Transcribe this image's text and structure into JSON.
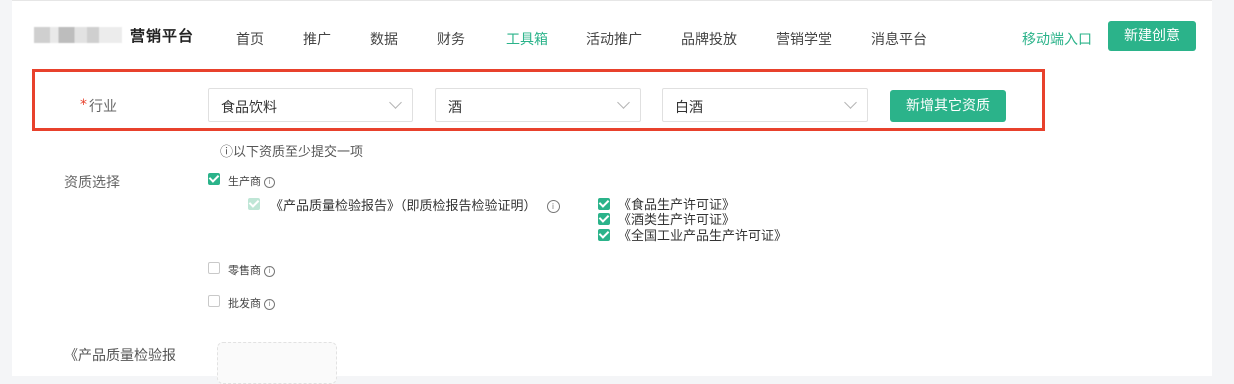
{
  "header": {
    "brand": "营销平台",
    "nav": [
      "首页",
      "推广",
      "数据",
      "财务",
      "工具箱",
      "活动推广",
      "品牌投放",
      "营销学堂",
      "消息平台"
    ],
    "active_nav": "工具箱",
    "mobile_link": "移动端入口",
    "create_button": "新建创意"
  },
  "industry": {
    "required_mark": "*",
    "label": "行业",
    "selects": [
      "食品饮料",
      "酒",
      "白酒"
    ],
    "add_button": "新增其它资质"
  },
  "qualification": {
    "hint": "ⓘ以下资质至少提交一项",
    "label": "资质选择",
    "options": [
      {
        "label": "生产商",
        "checked": true
      },
      {
        "label": "零售商",
        "checked": false
      },
      {
        "label": "批发商",
        "checked": false
      }
    ],
    "producer_docs": {
      "main_doc": "《产品质量检验报告》（即质检报告检验证明）",
      "sub_docs": [
        "《食品生产许可证》",
        "《酒类生产许可证》",
        "《全国工业产品生产许可证》"
      ]
    }
  },
  "upload_section": {
    "label_line1": "《产品质量检验报"
  },
  "colors": {
    "accent": "#2bb38a",
    "highlight_border": "#e8412c"
  }
}
